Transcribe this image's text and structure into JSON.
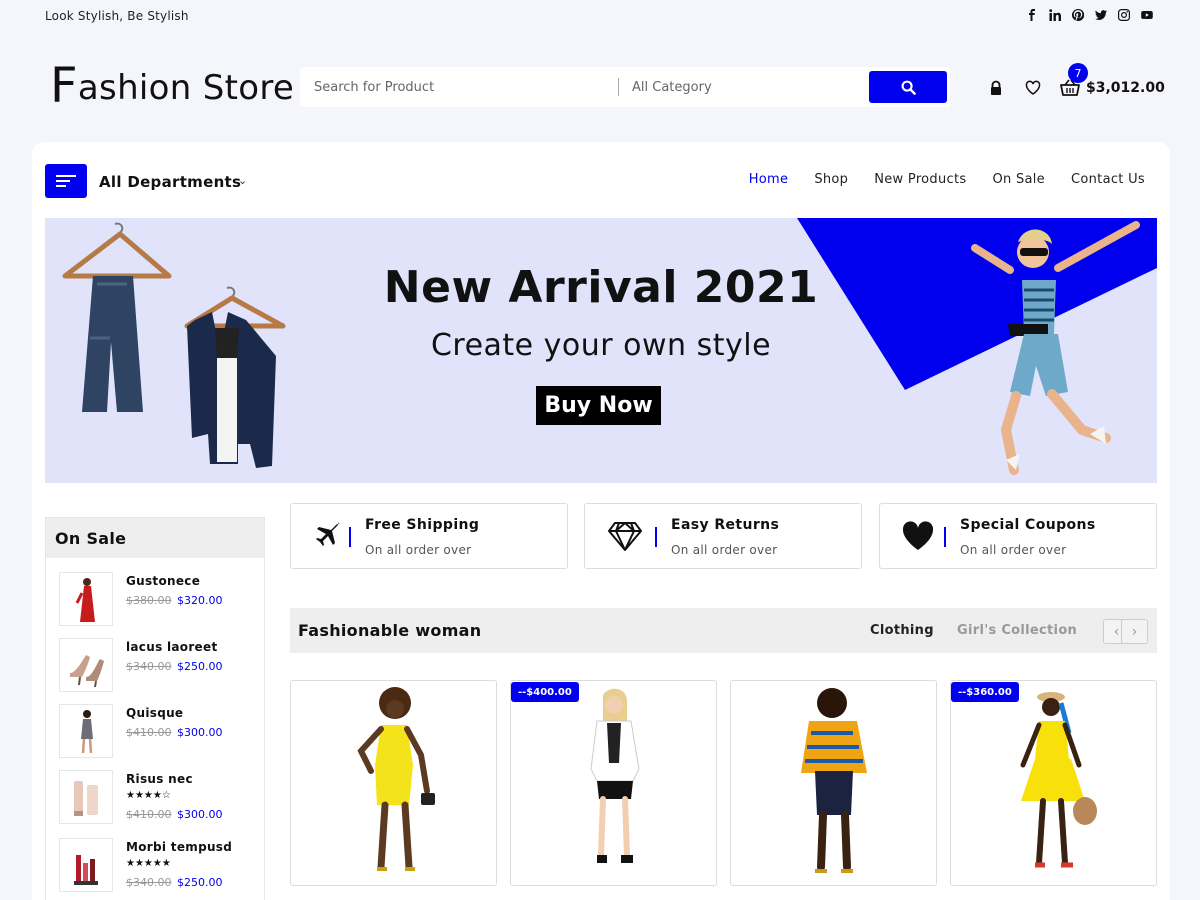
{
  "topbar": {
    "tagline": "Look Stylish, Be Stylish",
    "socials": [
      "facebook-icon",
      "linkedin-icon",
      "pinterest-icon",
      "twitter-icon",
      "instagram-icon",
      "youtube-icon"
    ]
  },
  "header": {
    "logo": {
      "first": "F",
      "rest": "ashion Store"
    },
    "search_placeholder": "Search for Product",
    "category": "All Category",
    "cart_count": "7",
    "cart_total": "$3,012.00"
  },
  "nav": {
    "departments": "All Departments",
    "links": [
      "Home",
      "Shop",
      "New Products",
      "On Sale",
      "Contact Us"
    ],
    "active": "Home"
  },
  "banner": {
    "title": "New Arrival 2021",
    "subtitle": "Create your own style",
    "cta": "Buy Now"
  },
  "sidebar": {
    "title": "On Sale",
    "items": [
      {
        "name": "Gustonece",
        "rating": "",
        "old_price": "$380.00",
        "price": "$320.00"
      },
      {
        "name": "lacus laoreet",
        "rating": "",
        "old_price": "$340.00",
        "price": "$250.00"
      },
      {
        "name": "Quisque",
        "rating": "",
        "old_price": "$410.00",
        "price": "$300.00"
      },
      {
        "name": "Risus nec",
        "rating": "★★★★☆",
        "old_price": "$410.00",
        "price": "$300.00"
      },
      {
        "name": "Morbi tempusd",
        "rating": "★★★★★",
        "old_price": "$340.00",
        "price": "$250.00"
      }
    ]
  },
  "features": [
    {
      "title": "Free Shipping",
      "subtitle": "On all order over",
      "icon": "airplane-icon"
    },
    {
      "title": "Easy Returns",
      "subtitle": "On all order over",
      "icon": "diamond-icon"
    },
    {
      "title": "Special Coupons",
      "subtitle": "On all order over",
      "icon": "heart-icon"
    }
  ],
  "section": {
    "title": "Fashionable woman",
    "tabs": [
      "Clothing",
      "Girl's Collection"
    ],
    "prev": "‹",
    "next": "›"
  },
  "products": [
    {
      "badge": "",
      "outfit": "#f4e21a"
    },
    {
      "badge": "--$400.00",
      "outfit": "#ffffff"
    },
    {
      "badge": "",
      "outfit": "#f0a413"
    },
    {
      "badge": "--$360.00",
      "outfit": "#f8e10a"
    }
  ],
  "colors": {
    "accent": "#0000ee",
    "banner_bg": "#e1e3fb",
    "page_bg": "#f5f6fb"
  }
}
